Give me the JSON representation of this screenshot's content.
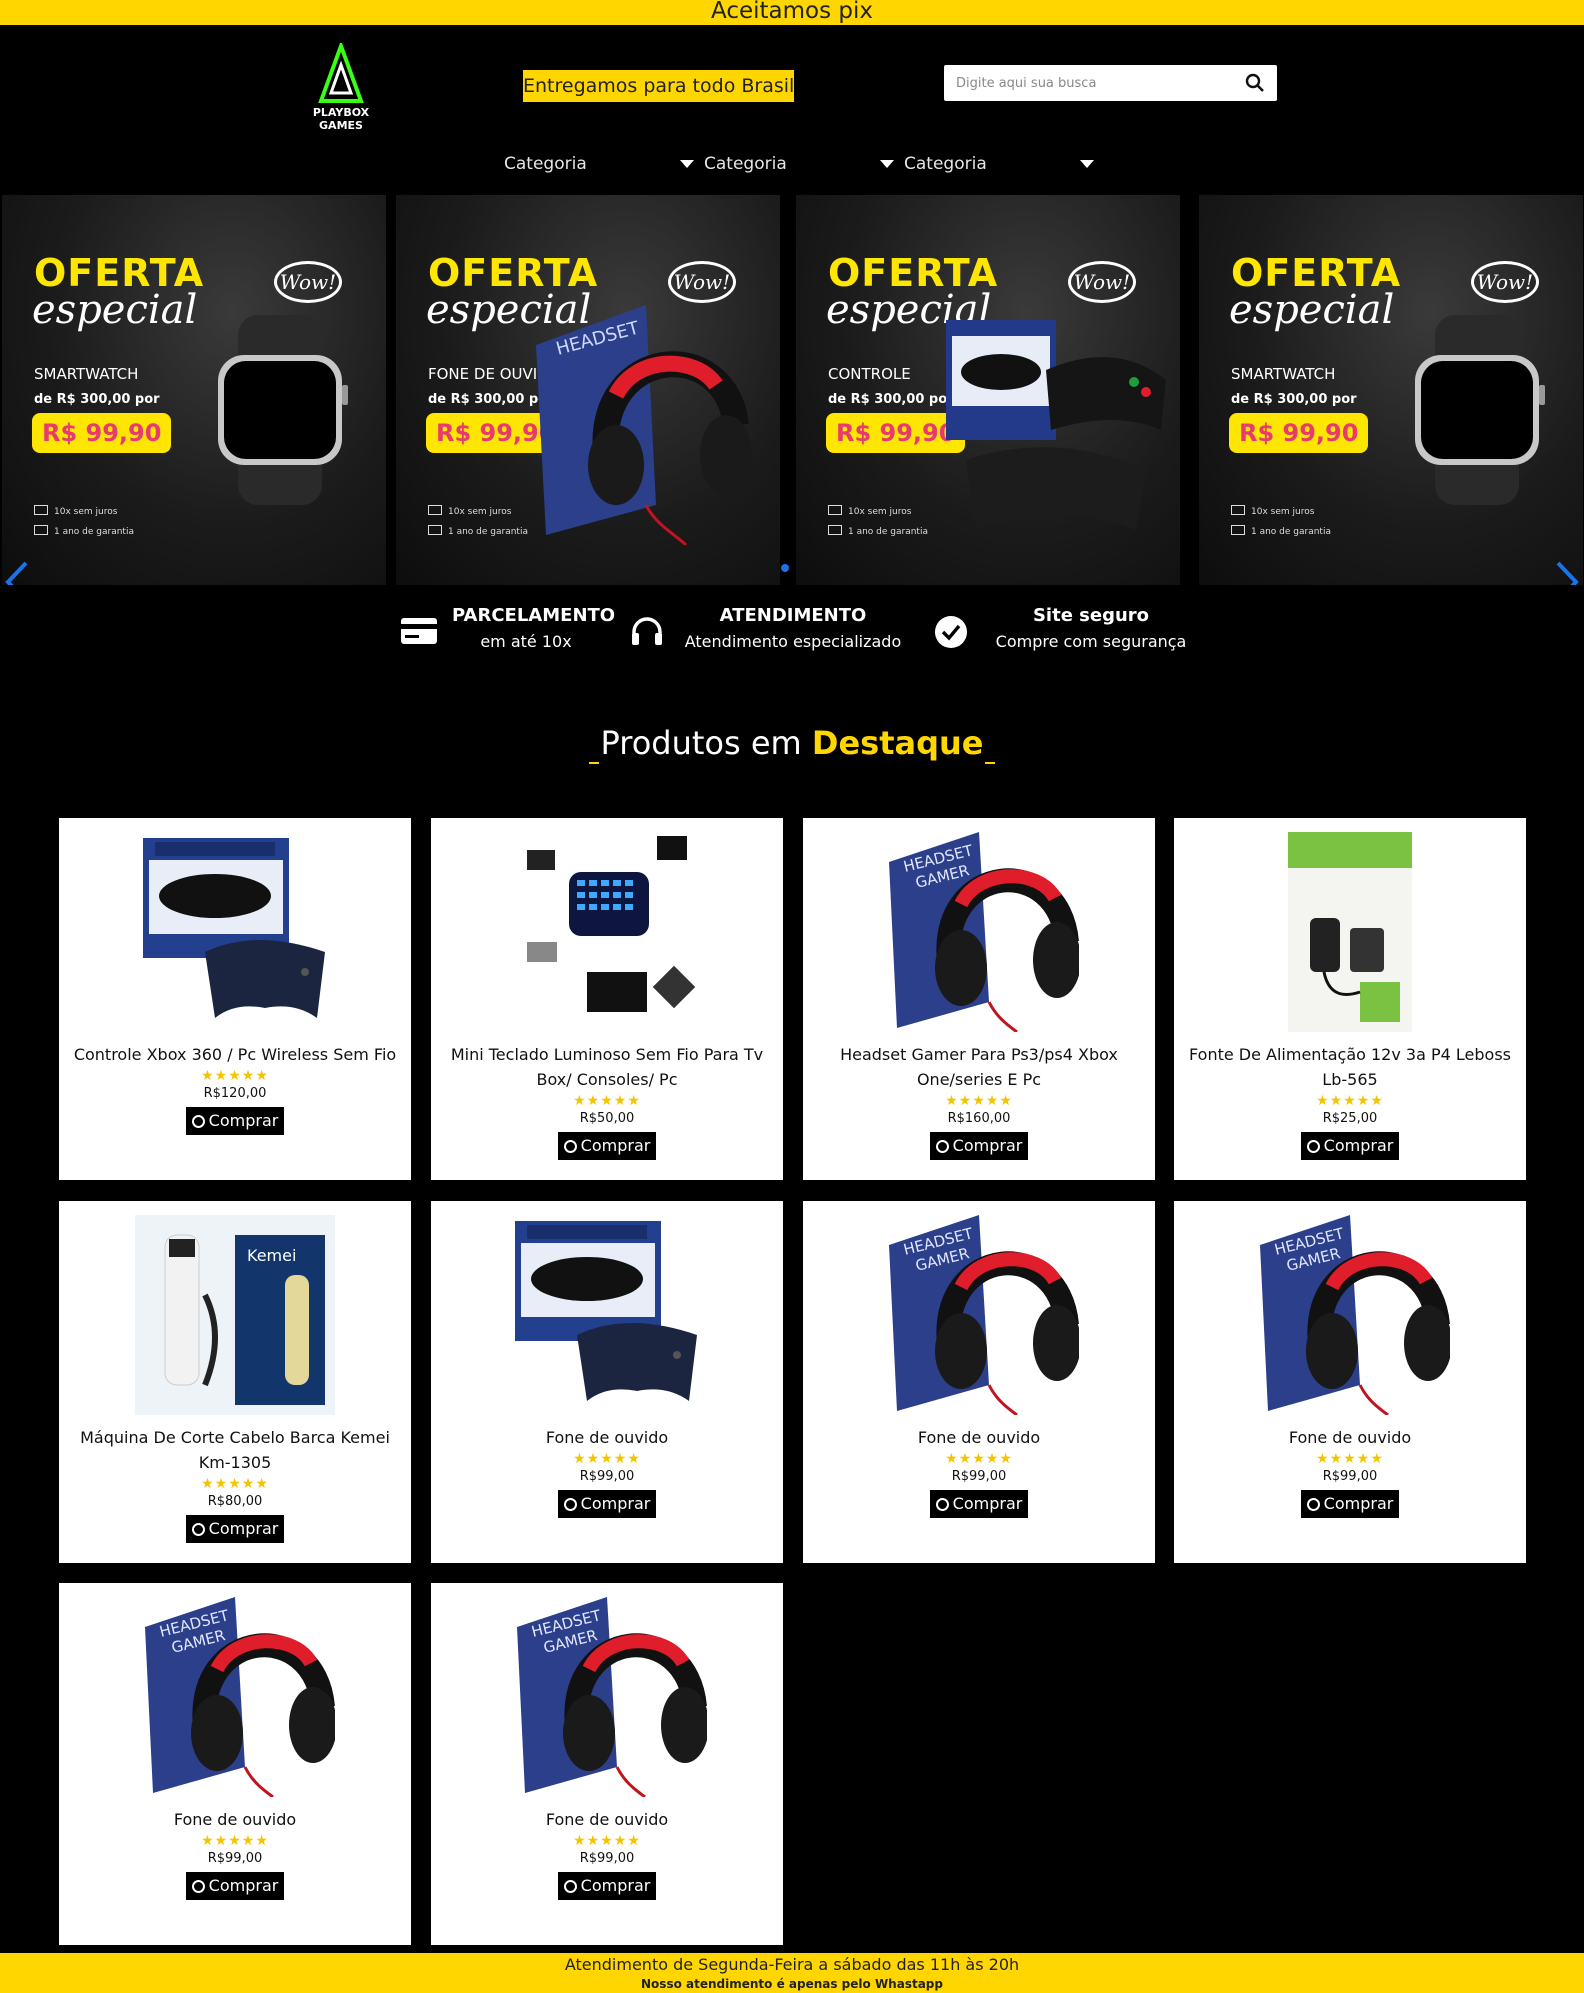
{
  "topbar": {
    "text": "Aceitamos pix"
  },
  "header": {
    "logo": {
      "line1": "PLAYBOX",
      "line2": "GAMES"
    },
    "delivery": "Entregamos para todo Brasil",
    "search": {
      "placeholder": "Digite aqui sua busca",
      "icon": "search-icon"
    },
    "categories": [
      "Categoria",
      "Categoria",
      "Categoria"
    ]
  },
  "slider": {
    "slides": [
      {
        "oferta": "OFERTA",
        "especial": "especial",
        "wow": "Wow!",
        "product": "SMARTWATCH",
        "was": "de R$ 300,00 por",
        "price": "R$ 99,90",
        "feat1": "10x sem juros",
        "feat2": "1 ano de garantia",
        "kind": "watch"
      },
      {
        "oferta": "OFERTA",
        "especial": "especial",
        "wow": "Wow!",
        "product": "FONE DE OUVIDO",
        "was": "de R$ 300,00 por",
        "price": "R$ 99,90",
        "feat1": "10x sem juros",
        "feat2": "1 ano de garantia",
        "kind": "headset"
      },
      {
        "oferta": "OFERTA",
        "especial": "especial",
        "wow": "Wow!",
        "product": "CONTROLE",
        "was": "de R$ 300,00 por",
        "price": "R$ 99,90",
        "feat1": "10x sem juros",
        "feat2": "1 ano de garantia",
        "kind": "controller"
      },
      {
        "oferta": "OFERTA",
        "especial": "especial",
        "wow": "Wow!",
        "product": "SMARTWATCH",
        "was": "de R$ 300,00 por",
        "price": "R$ 99,90",
        "feat1": "10x sem juros",
        "feat2": "1 ano de garantia",
        "kind": "watch"
      }
    ],
    "active_dot": 1
  },
  "features": [
    {
      "title": "PARCELAMENTO",
      "subtitle": "em até 10x",
      "icon": "credit-card-icon"
    },
    {
      "title": "ATENDIMENTO",
      "subtitle": "Atendimento especializado",
      "icon": "headphones-icon"
    },
    {
      "title": "Site seguro",
      "subtitle": "Compre com segurança",
      "icon": "check-circle-icon"
    }
  ],
  "section": {
    "title_plain": "Produtos em",
    "title_highlight": "Destaque"
  },
  "products": [
    {
      "name": "Controle Xbox 360 / Pc Wireless Sem Fio",
      "stars": "★★★★★",
      "price": "R$120,00",
      "buy": "Comprar",
      "image": "controller"
    },
    {
      "name": "Mini Teclado Luminoso Sem Fio Para Tv Box/ Consoles/ Pc",
      "stars": "★★★★★",
      "price": "R$50,00",
      "buy": "Comprar",
      "image": "keyboard"
    },
    {
      "name": "Headset Gamer Para Ps3/ps4 Xbox One/series E Pc",
      "stars": "★★★★★",
      "price": "R$160,00",
      "buy": "Comprar",
      "image": "headset"
    },
    {
      "name": "Fonte De Alimentação 12v 3a P4 Leboss Lb-565",
      "stars": "★★★★★",
      "price": "R$25,00",
      "buy": "Comprar",
      "image": "charger"
    },
    {
      "name": "Máquina De Corte Cabelo Barca Kemei Km-1305",
      "stars": "★★★★★",
      "price": "R$80,00",
      "buy": "Comprar",
      "image": "clipper"
    },
    {
      "name": "Fone de ouvido",
      "stars": "★★★★★",
      "price": "R$99,00",
      "buy": "Comprar",
      "image": "controller"
    },
    {
      "name": "Fone de ouvido",
      "stars": "★★★★★",
      "price": "R$99,00",
      "buy": "Comprar",
      "image": "headset"
    },
    {
      "name": "Fone de ouvido",
      "stars": "★★★★★",
      "price": "R$99,00",
      "buy": "Comprar",
      "image": "headset"
    },
    {
      "name": "Fone de ouvido",
      "stars": "★★★★★",
      "price": "R$99,00",
      "buy": "Comprar",
      "image": "headset"
    },
    {
      "name": "Fone de ouvido",
      "stars": "★★★★★",
      "price": "R$99,00",
      "buy": "Comprar",
      "image": "headset"
    }
  ],
  "footer": {
    "line1": "Atendimento de Segunda-Feira a sábado das 11h às 20h",
    "line2": "Nosso atendimento é apenas pelo Whastapp"
  },
  "colors": {
    "accent": "#ffd600",
    "background": "#000000",
    "price_pink": "#e83a6f",
    "logo_green": "#39ff14"
  }
}
